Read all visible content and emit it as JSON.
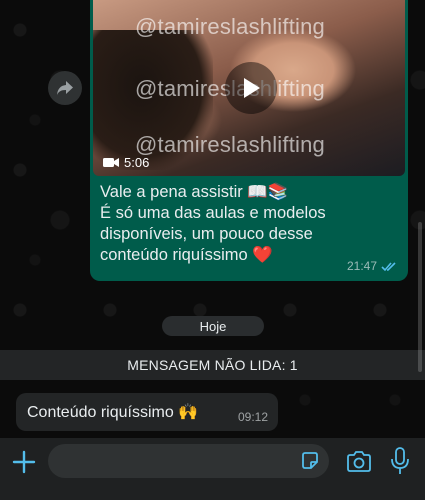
{
  "outgoing_message": {
    "watermarks": [
      "@tamireslashlifting",
      "@tamireslashlifting",
      "@tamireslashlifting"
    ],
    "video_duration": "5:06",
    "caption_lines": [
      "Vale a pena assistir 📖📚",
      "É só uma das aulas  e modelos",
      "disponíveis, um pouco desse",
      "conteúdo riquíssimo ❤️"
    ],
    "time": "21:47",
    "status": "read"
  },
  "date_separator": "Hoje",
  "unread_banner": "MENSAGEM NÃO LIDA: 1",
  "incoming_message": {
    "text": "Conteúdo riquíssimo 🙌",
    "time": "09:12"
  },
  "icons": {
    "forward": "forward-arrow-icon",
    "play": "play-icon",
    "video": "video-camera-icon",
    "read_receipt": "double-check-icon",
    "attach": "plus-icon",
    "sticker": "sticker-icon",
    "camera": "camera-icon",
    "mic": "microphone-icon"
  },
  "colors": {
    "outgoing_bubble": "#005c4b",
    "incoming_bubble": "#232526",
    "accent": "#53bdeb",
    "background": "#0b0b0b"
  }
}
